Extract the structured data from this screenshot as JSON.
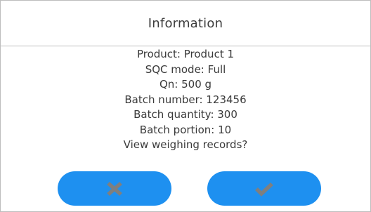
{
  "dialog": {
    "title": "Information",
    "lines": [
      "Product: Product 1",
      "SQC mode: Full",
      "Qn: 500 g",
      "Batch number: 123456",
      "Batch quantity: 300",
      "Batch portion: 10",
      "View weighing records?"
    ],
    "buttons": {
      "cancel_icon": "close-icon",
      "confirm_icon": "checkmark-icon"
    }
  },
  "colors": {
    "button_fill": "#1e90f0",
    "icon_gray": "#7f7f7f",
    "border": "#bdbdbd"
  }
}
